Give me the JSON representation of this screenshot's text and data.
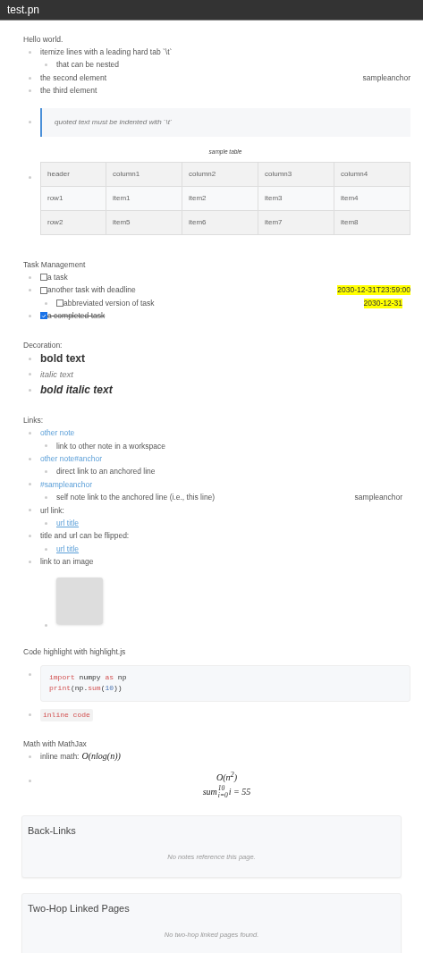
{
  "header": {
    "title": "test.pn"
  },
  "sections": [
    {
      "heading": "Hello world.",
      "items": [
        {
          "kind": "text",
          "text": "itemize lines with a leading hard tab `\\t`",
          "children": [
            {
              "kind": "text",
              "text": "that can be nested"
            }
          ]
        },
        {
          "kind": "text",
          "text": "the second element",
          "anchor": "sampleanchor"
        },
        {
          "kind": "text",
          "text": "the third element"
        },
        {
          "kind": "quote",
          "text": "quoted text must be indented with `\\t`"
        },
        {
          "kind": "table",
          "caption": "sample table",
          "columns": [
            "header",
            "column1",
            "column2",
            "column3",
            "column4"
          ],
          "rows": [
            [
              "row1",
              "item1",
              "item2",
              "item3",
              "item4"
            ],
            [
              "row2",
              "item5",
              "item6",
              "item7",
              "item8"
            ]
          ]
        }
      ]
    },
    {
      "heading": "Task Management",
      "items": [
        {
          "kind": "task",
          "text": "a task",
          "checked": false
        },
        {
          "kind": "task",
          "text": "another task with deadline",
          "checked": false,
          "deadline": "2030-12-31T23:59:00",
          "children": [
            {
              "kind": "task",
              "text": "abbreviated version of task",
              "checked": false,
              "deadline": "2030-12-31"
            }
          ]
        },
        {
          "kind": "task",
          "text": "a completed task",
          "checked": true
        }
      ]
    },
    {
      "heading": "Decoration:",
      "items": [
        {
          "kind": "bold",
          "text": "bold text"
        },
        {
          "kind": "italic",
          "text": "italic text"
        },
        {
          "kind": "bold_italic",
          "text": "bold italic text"
        }
      ]
    },
    {
      "heading": "Links:",
      "items": [
        {
          "kind": "link",
          "text": "other note",
          "children": [
            {
              "kind": "text",
              "text": "link to other note in a workspace"
            }
          ]
        },
        {
          "kind": "link",
          "text": "other note#anchor",
          "children": [
            {
              "kind": "text",
              "text": "direct link to an anchored line"
            }
          ]
        },
        {
          "kind": "link",
          "text": "#sampleanchor",
          "children": [
            {
              "kind": "text",
              "text": "self note link to the anchored line (i.e., this line)",
              "anchor": "sampleanchor"
            }
          ]
        },
        {
          "kind": "text",
          "text": "url link:",
          "children": [
            {
              "kind": "url",
              "text": "url title"
            }
          ]
        },
        {
          "kind": "text",
          "text": "title and url can be flipped:",
          "children": [
            {
              "kind": "url",
              "text": "url title"
            }
          ]
        },
        {
          "kind": "text",
          "text": "link to an image",
          "children": [
            {
              "kind": "image"
            }
          ]
        }
      ]
    },
    {
      "heading": "Code highlight with highlight.js",
      "items": [
        {
          "kind": "code",
          "lines": [
            [
              {
                "kind": "keyword",
                "text": "import"
              },
              {
                "kind": "plain",
                "text": " numpy "
              },
              {
                "kind": "keyword",
                "text": "as"
              },
              {
                "kind": "plain",
                "text": " np"
              }
            ],
            [
              {
                "kind": "keyword",
                "text": "print"
              },
              {
                "kind": "plain",
                "text": "(np."
              },
              {
                "kind": "keyword",
                "text": "sum"
              },
              {
                "kind": "plain",
                "text": "("
              },
              {
                "kind": "number",
                "text": "10"
              },
              {
                "kind": "plain",
                "text": "))"
              }
            ]
          ]
        },
        {
          "kind": "inline_code",
          "text": "inline code"
        }
      ]
    },
    {
      "heading": "Math with MathJax",
      "items": [
        {
          "kind": "math_inline",
          "label": "inline math:",
          "math": "O(nlog(n))"
        },
        {
          "kind": "math_block",
          "lines": [
            {
              "kind": "plain",
              "text": "O(n$^{2}$)"
            },
            {
              "kind": "limits",
              "base": "sum",
              "sup": "10",
              "sub": "i=0",
              "rest": "i = 55"
            }
          ]
        }
      ]
    }
  ],
  "panels": [
    {
      "title": "Back-Links",
      "message": "No notes reference this page."
    },
    {
      "title": "Two-Hop Linked Pages",
      "message": "No two-hop linked pages found."
    }
  ]
}
